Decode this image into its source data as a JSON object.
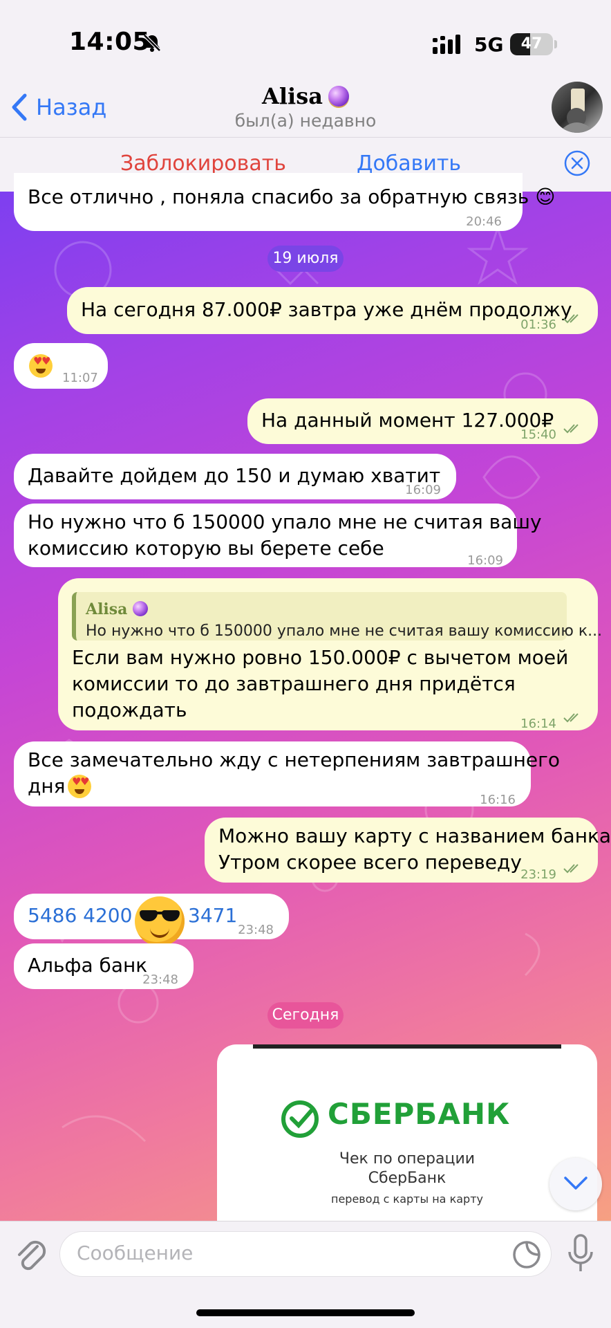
{
  "status_bar": {
    "time": "14:05",
    "network": "5G",
    "battery": "47",
    "battery_level": 0.47
  },
  "header": {
    "back_label": "Назад",
    "contact_name": "Alisa",
    "status": "был(а) недавно"
  },
  "action_bar": {
    "block_label": "Заблокировать",
    "add_label": "Добавить"
  },
  "messages": [
    {
      "dir": "in",
      "text": "Все отлично , поняла спасибо за обратную связь 😊",
      "time": "20:46"
    },
    {
      "dir": "date",
      "text": "19 июля"
    },
    {
      "dir": "out",
      "text": "На сегодня 87.000₽ завтра уже днём продолжу",
      "time": "01:36"
    },
    {
      "dir": "in",
      "text": "😍",
      "time": "11:07"
    },
    {
      "dir": "out",
      "text": "На данный момент 127.000₽",
      "time": "15:40"
    },
    {
      "dir": "in",
      "text": "Давайте дойдем до 150 и думаю хватит",
      "time": "16:09"
    },
    {
      "dir": "in",
      "line1": "Но нужно что б 150000 упало мне не считая вашу",
      "line2": "комиссию которую вы берете себе",
      "time": "16:09"
    },
    {
      "dir": "out",
      "reply_name": "Alisa",
      "reply_text": "Но нужно что б 150000 упало мне не считая вашу комиссию к...",
      "line1": "Если вам нужно ровно 150.000₽ с вычетом моей",
      "line2": "комиссии то до завтрашнего дня придётся",
      "line3": "подождать",
      "time": "16:14"
    },
    {
      "dir": "in",
      "line1": "Все замечательно жду с нетерпениям завтрашнего",
      "line2": "дня",
      "time": "16:16"
    },
    {
      "dir": "out",
      "line1": "Можно вашу карту с названием банка",
      "line2": "Утром скорее всего переведу",
      "time": "23:19"
    },
    {
      "dir": "in",
      "part1": "5486 4200",
      "part2": "3471",
      "time": "23:48"
    },
    {
      "dir": "in",
      "text": "Альфа банк",
      "time": "23:48"
    },
    {
      "dir": "date",
      "text": "Сегодня"
    },
    {
      "dir": "out",
      "type": "image",
      "brand": "СБЕРБАНК",
      "title_line1": "Чек по операции",
      "title_line2": "СберБанк",
      "subtitle": "перевод с карты на карту"
    }
  ],
  "input": {
    "placeholder": "Сообщение"
  },
  "colors": {
    "accent": "#3478f6",
    "danger": "#e0443d",
    "outgoing": "#fdfbd8",
    "incoming": "#ffffff",
    "sber_green": "#21a038"
  }
}
